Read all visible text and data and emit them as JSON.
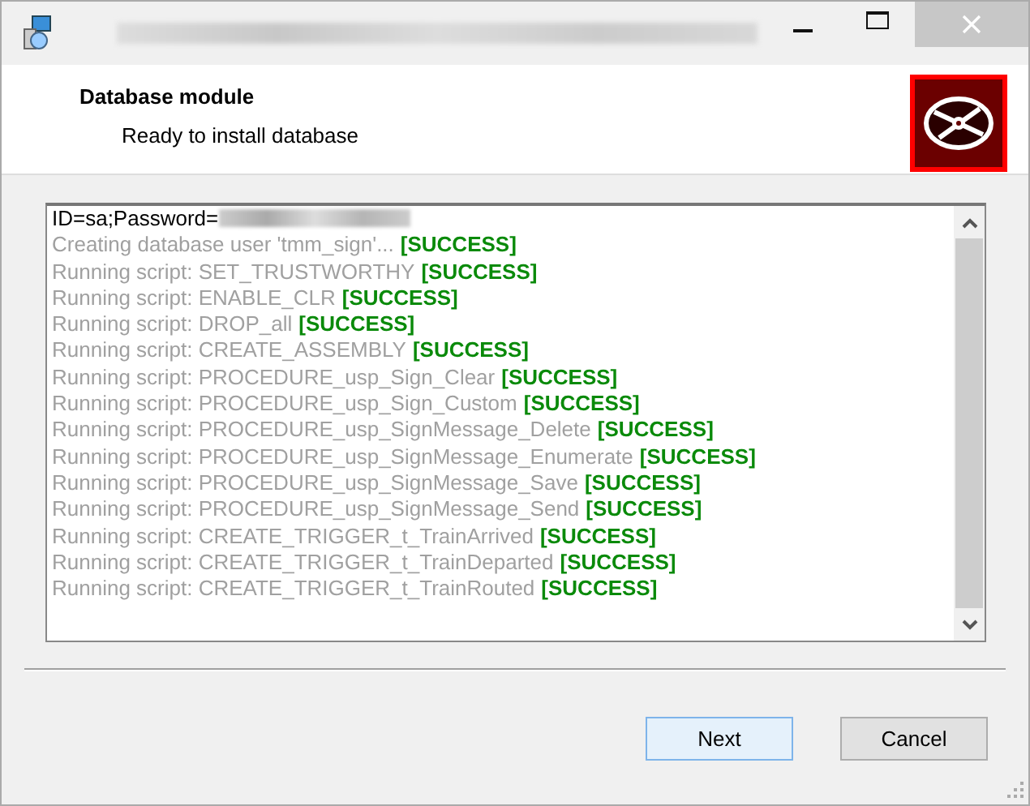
{
  "header": {
    "title": "Database module",
    "subtitle": "Ready to install database"
  },
  "log": [
    {
      "kind": "credentials",
      "text": "ID=sa;Password=",
      "redacted": true
    },
    {
      "kind": "step",
      "text": "Creating database user 'tmm_sign'...",
      "status": "[SUCCESS]"
    },
    {
      "kind": "step",
      "text": "Running script: SET_TRUSTWORTHY",
      "status": "[SUCCESS]"
    },
    {
      "kind": "step",
      "text": "Running script: ENABLE_CLR",
      "status": "[SUCCESS]"
    },
    {
      "kind": "step",
      "text": "Running script: DROP_all",
      "status": "[SUCCESS]"
    },
    {
      "kind": "step",
      "text": "Running script: CREATE_ASSEMBLY",
      "status": "[SUCCESS]"
    },
    {
      "kind": "step",
      "text": "Running script: PROCEDURE_usp_Sign_Clear",
      "status": "[SUCCESS]"
    },
    {
      "kind": "step",
      "text": "Running script: PROCEDURE_usp_Sign_Custom",
      "status": "[SUCCESS]"
    },
    {
      "kind": "step",
      "text": "Running script: PROCEDURE_usp_SignMessage_Delete",
      "status": "[SUCCESS]"
    },
    {
      "kind": "step",
      "text": "Running script: PROCEDURE_usp_SignMessage_Enumerate",
      "status": "[SUCCESS]"
    },
    {
      "kind": "step",
      "text": "Running script: PROCEDURE_usp_SignMessage_Save",
      "status": "[SUCCESS]"
    },
    {
      "kind": "step",
      "text": "Running script: PROCEDURE_usp_SignMessage_Send",
      "status": "[SUCCESS]"
    },
    {
      "kind": "step",
      "text": "Running script: CREATE_TRIGGER_t_TrainArrived",
      "status": "[SUCCESS]"
    },
    {
      "kind": "step",
      "text": "Running script: CREATE_TRIGGER_t_TrainDeparted",
      "status": "[SUCCESS]"
    },
    {
      "kind": "step",
      "text": "Running script: CREATE_TRIGGER_t_TrainRouted",
      "status": "[SUCCESS]"
    }
  ],
  "buttons": [
    {
      "label": "Next",
      "default": true
    },
    {
      "label": "Cancel",
      "default": false
    }
  ]
}
